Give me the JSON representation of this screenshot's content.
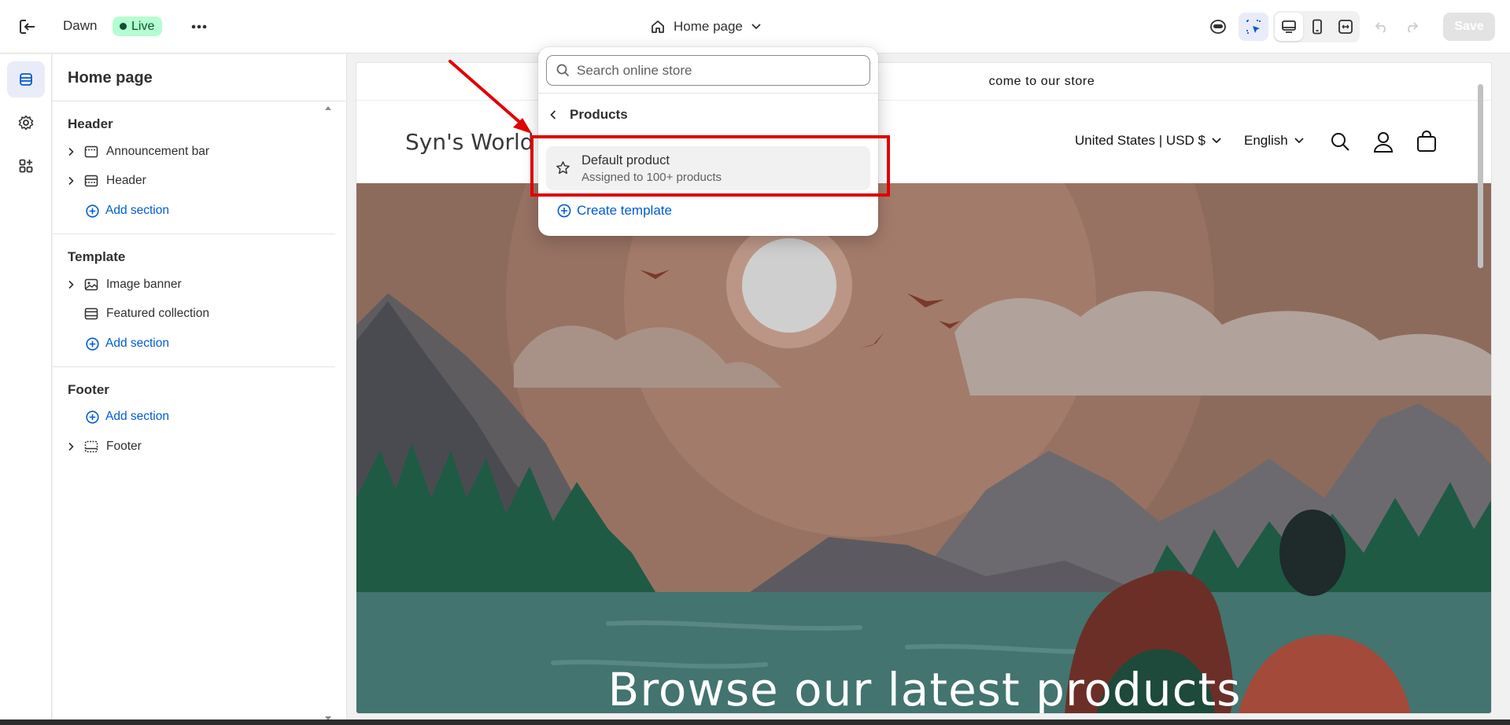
{
  "topbar": {
    "theme_name": "Dawn",
    "status_label": "Live",
    "page_selector_label": "Home page",
    "save_label": "Save"
  },
  "sidebar": {
    "title": "Home page",
    "groups": [
      {
        "title": "Header",
        "items": [
          {
            "label": "Announcement bar",
            "icon": "announcement-bar-icon",
            "expandable": true
          },
          {
            "label": "Header",
            "icon": "header-section-icon",
            "expandable": true
          }
        ],
        "add_label": "Add section"
      },
      {
        "title": "Template",
        "items": [
          {
            "label": "Image banner",
            "icon": "image-banner-icon",
            "expandable": true
          },
          {
            "label": "Featured collection",
            "icon": "featured-collection-icon",
            "expandable": false
          }
        ],
        "add_label": "Add section"
      },
      {
        "title": "Footer",
        "items": [
          {
            "label": "Footer",
            "icon": "footer-section-icon",
            "expandable": true
          }
        ],
        "add_label": "Add section"
      }
    ]
  },
  "dropdown": {
    "search_placeholder": "Search online store",
    "back_label": "Products",
    "option_title": "Default product",
    "option_subtitle": "Assigned to 100+ products",
    "create_label": "Create template"
  },
  "preview": {
    "announcement_text": "come to our store",
    "logo_text": "Syn's World",
    "country_label": "United States | USD $",
    "language_label": "English",
    "hero_title": "Browse our latest products"
  },
  "colors": {
    "accent_blue": "#005bd3",
    "live_badge_bg": "#b4fed2",
    "annotation_red": "#e00000"
  }
}
